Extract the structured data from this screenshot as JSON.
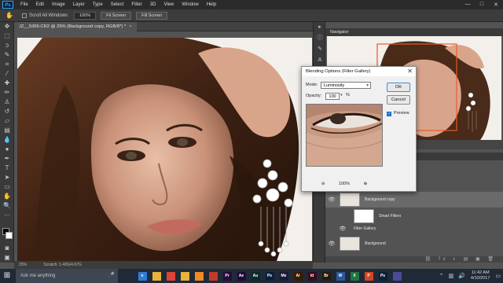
{
  "menu": {
    "logo": "Ps",
    "items": [
      "File",
      "Edit",
      "Image",
      "Layer",
      "Type",
      "Select",
      "Filter",
      "3D",
      "View",
      "Window",
      "Help"
    ],
    "window_controls": [
      "—",
      "□",
      "✕"
    ]
  },
  "options_bar": {
    "scroll_all_windows": "Scroll All Windows",
    "zoom_value": "100%",
    "fit_screen": "Fit Screen",
    "fill_screen": "Fill Screen"
  },
  "document": {
    "tab_title": "JZ__5369.CR2 @ 25% (Background copy, RGB/8*) *",
    "close": "×"
  },
  "status_bar": {
    "zoom": "25%",
    "info": "Scratch: 1.40G/4.67G"
  },
  "navigator": {
    "title": "Navigator"
  },
  "layers": [
    {
      "name": "Background copy",
      "italic": false
    },
    {
      "name": "Smart Filters",
      "italic": false
    },
    {
      "name": "Filter Gallery",
      "italic": false
    },
    {
      "name": "Background",
      "italic": true
    }
  ],
  "dialog": {
    "title": "Blending Options (Filter Gallery)",
    "close": "✕",
    "mode_label": "Mode:",
    "mode_value": "Luminosity",
    "opacity_label": "Opacity:",
    "opacity_value": "100",
    "percent": "%",
    "ok": "OK",
    "cancel": "Cancel",
    "preview_label": "Preview",
    "preview_checked": true,
    "zoom_out": "⊖",
    "zoom_level": "100%",
    "zoom_in": "⊕"
  },
  "taskbar": {
    "search_placeholder": "Ask me anything",
    "time": "11:42 AM",
    "date": "4/10/2017",
    "apps": [
      {
        "icon": "task-view-icon",
        "label": "",
        "color": "#1f2a36"
      },
      {
        "icon": "edge-icon",
        "label": "e",
        "color": "#2f7bd6"
      },
      {
        "icon": "folder-icon",
        "label": "",
        "color": "#e8b43a"
      },
      {
        "icon": "chrome-icon",
        "label": "",
        "color": "#db4437"
      },
      {
        "icon": "folder-icon",
        "label": "",
        "color": "#e8b43a"
      },
      {
        "icon": "vlc-icon",
        "label": "",
        "color": "#f08a24"
      },
      {
        "icon": "app-icon",
        "label": "",
        "color": "#c23a2a"
      },
      {
        "icon": "premiere-icon",
        "label": "Pr",
        "color": "#2a0a3a"
      },
      {
        "icon": "after-effects-icon",
        "label": "Ae",
        "color": "#1f0a3a"
      },
      {
        "icon": "audition-icon",
        "label": "Au",
        "color": "#0a2a2a"
      },
      {
        "icon": "photoshop-icon",
        "label": "Ps",
        "color": "#0a1f3c"
      },
      {
        "icon": "media-encoder-icon",
        "label": "Me",
        "color": "#1a1a3a"
      },
      {
        "icon": "illustrator-icon",
        "label": "Ai",
        "color": "#3a1a00"
      },
      {
        "icon": "indesign-icon",
        "label": "Id",
        "color": "#3a0a1a"
      },
      {
        "icon": "bridge-icon",
        "label": "Br",
        "color": "#2a1a0a"
      },
      {
        "icon": "word-icon",
        "label": "W",
        "color": "#2b579a"
      },
      {
        "icon": "excel-icon",
        "label": "X",
        "color": "#217346"
      },
      {
        "icon": "powerpoint-icon",
        "label": "P",
        "color": "#d24726"
      },
      {
        "icon": "photoshop-active-icon",
        "label": "Ps",
        "color": "#0a1f3c"
      },
      {
        "icon": "app-icon",
        "label": "",
        "color": "#4a4a9a"
      }
    ]
  },
  "colors": {
    "app_bg": "#535353",
    "panel_dark": "#3a3a3a",
    "accent_blue": "#31a8ff",
    "selection_box": "#e85a2a"
  }
}
